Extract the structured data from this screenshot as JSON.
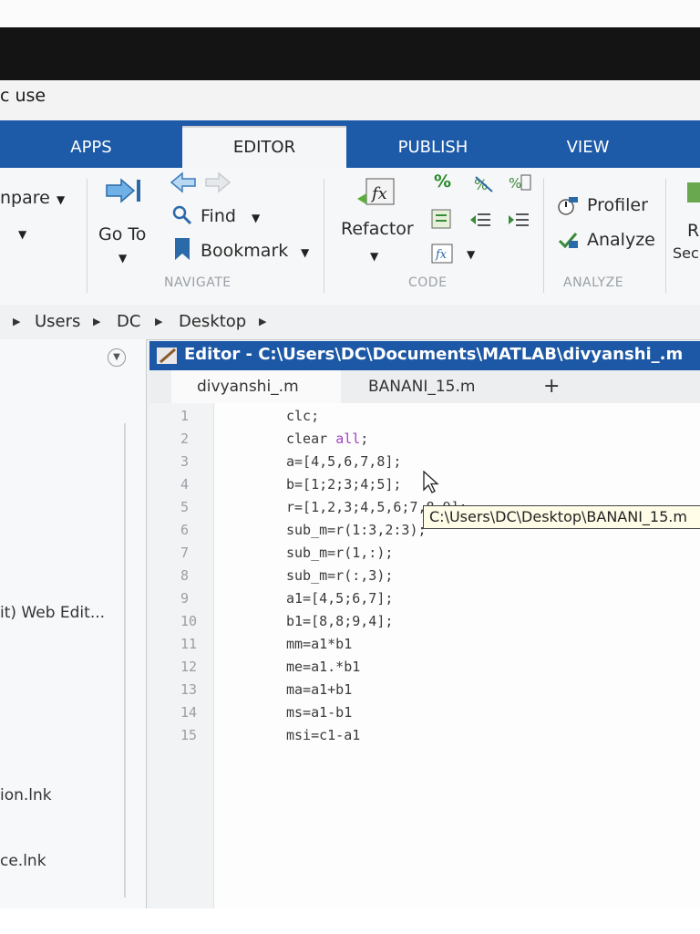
{
  "window": {
    "title_fragment": "c use"
  },
  "tabs": [
    {
      "label": "APPS"
    },
    {
      "label": "EDITOR"
    },
    {
      "label": "PUBLISH"
    },
    {
      "label": "VIEW"
    }
  ],
  "ribbon": {
    "compare": "npare",
    "goto": "Go To",
    "find": "Find",
    "bookmark": "Bookmark",
    "navigate_group": "NAVIGATE",
    "refactor": "Refactor",
    "code_group": "CODE",
    "profiler": "Profiler",
    "analyze": "Analyze",
    "analyze_group": "ANALYZE",
    "run_partial": "R",
    "section_partial": "Sec"
  },
  "address": {
    "parts": [
      "Users",
      "DC",
      "Desktop"
    ]
  },
  "left_panel": {
    "items": [
      "it) Web Edit...",
      "ion.lnk",
      "ce.lnk",
      ".lnk"
    ]
  },
  "editor": {
    "title": "Editor - C:\\Users\\DC\\Documents\\MATLAB\\divyanshi_.m",
    "file_tabs": [
      "divyanshi_.m",
      "BANANI_15.m"
    ],
    "add_tab": "+",
    "tooltip": "C:\\Users\\DC\\Desktop\\BANANI_15.m",
    "lines": [
      {
        "num": "1",
        "pre": "clc;",
        "kw": "",
        "post": ""
      },
      {
        "num": "2",
        "pre": "clear ",
        "kw": "all",
        "post": ";"
      },
      {
        "num": "3",
        "pre": "a=[4,5,6,7,8];",
        "kw": "",
        "post": ""
      },
      {
        "num": "4",
        "pre": "b=[1;2;3;4;5];",
        "kw": "",
        "post": ""
      },
      {
        "num": "5",
        "pre": "r=[1,2,3;4,5,6;7,8,9];",
        "kw": "",
        "post": ""
      },
      {
        "num": "6",
        "pre": "sub_m=r(1:3,2:3);",
        "kw": "",
        "post": ""
      },
      {
        "num": "7",
        "pre": "sub_m=r(1,:);",
        "kw": "",
        "post": ""
      },
      {
        "num": "8",
        "pre": "sub_m=r(:,3);",
        "kw": "",
        "post": ""
      },
      {
        "num": "9",
        "pre": "a1=[4,5;6,7];",
        "kw": "",
        "post": ""
      },
      {
        "num": "10",
        "pre": "b1=[8,8;9,4];",
        "kw": "",
        "post": ""
      },
      {
        "num": "11",
        "pre": "mm=a1*b1",
        "kw": "",
        "post": ""
      },
      {
        "num": "12",
        "pre": "me=a1.*b1",
        "kw": "",
        "post": ""
      },
      {
        "num": "13",
        "pre": "ma=a1+b1",
        "kw": "",
        "post": ""
      },
      {
        "num": "14",
        "pre": "ms=a1-b1",
        "kw": "",
        "post": ""
      },
      {
        "num": "15",
        "pre": "msi=c1-a1",
        "kw": "",
        "post": ""
      }
    ]
  },
  "colors": {
    "tab_blue": "#1d5aa8",
    "editor_title_blue": "#1c58a6",
    "keyword_purple": "#a042c0"
  }
}
